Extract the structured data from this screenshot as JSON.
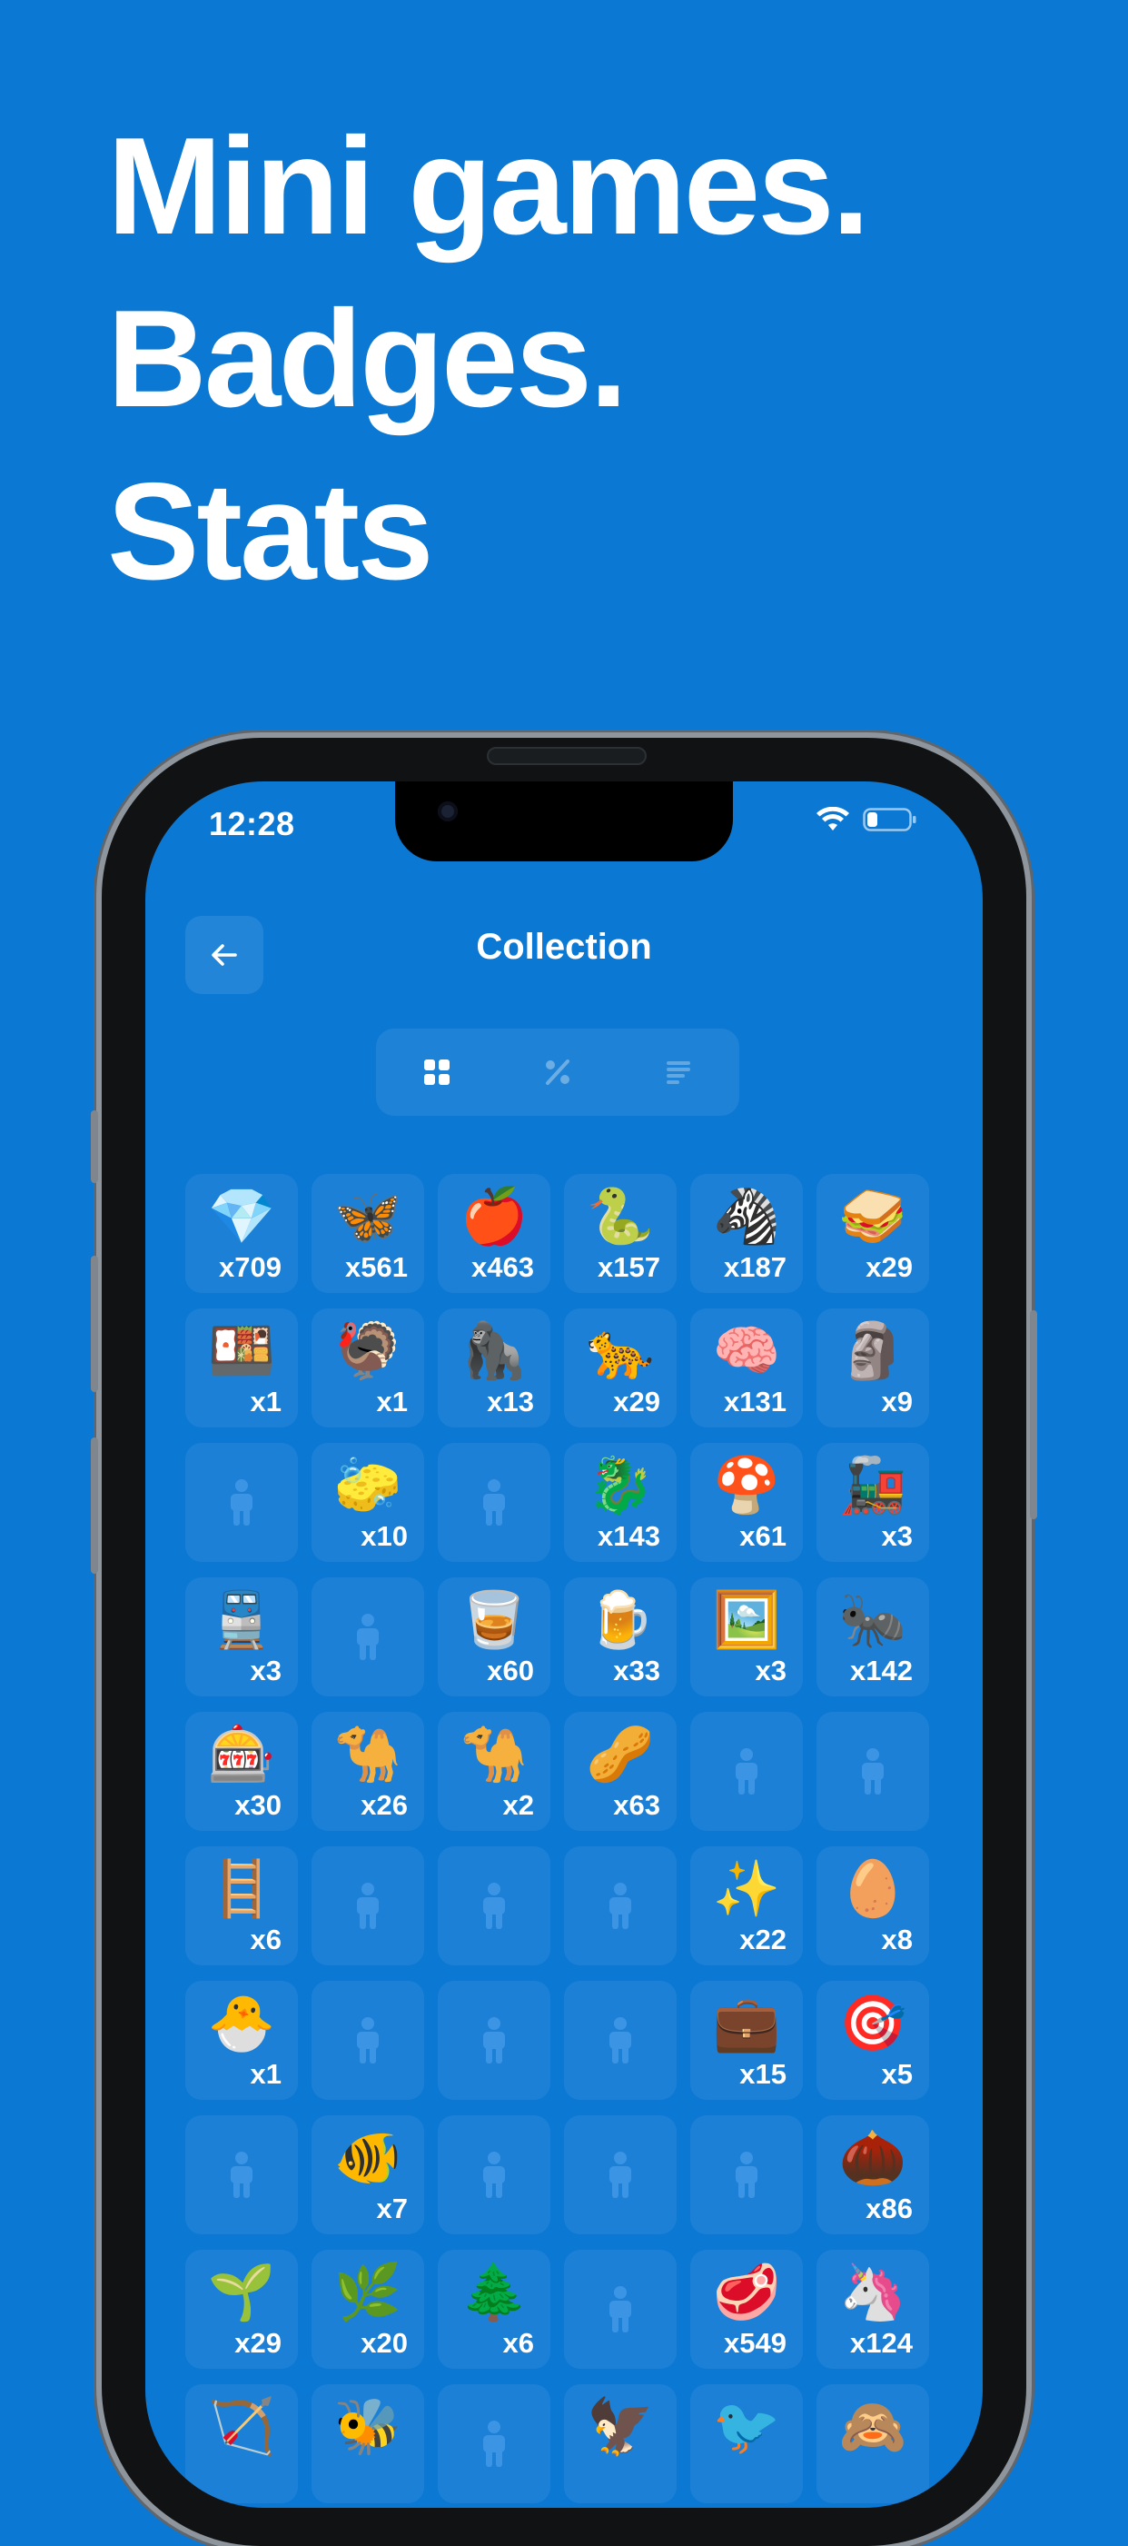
{
  "headline": [
    "Mini games.",
    "Badges.",
    "Stats"
  ],
  "status_bar": {
    "time": "12:28",
    "icons": [
      "wifi-icon",
      "battery-icon"
    ]
  },
  "screen": {
    "title": "Collection",
    "back_icon": "arrow-left-icon",
    "tabs": [
      {
        "icon": "grid-icon",
        "selected": true
      },
      {
        "icon": "percent-icon",
        "selected": false
      },
      {
        "icon": "list-icon",
        "selected": false
      }
    ]
  },
  "collection": [
    {
      "emoji": "💎",
      "count": "x709"
    },
    {
      "emoji": "🦋",
      "count": "x561"
    },
    {
      "emoji": "🍎",
      "count": "x463"
    },
    {
      "emoji": "🐍",
      "count": "x157"
    },
    {
      "emoji": "🦓",
      "count": "x187"
    },
    {
      "emoji": "🥪",
      "count": "x29"
    },
    {
      "emoji": "🍱",
      "count": "x1"
    },
    {
      "emoji": "🦃",
      "count": "x1"
    },
    {
      "emoji": "🦍",
      "count": "x13"
    },
    {
      "emoji": "🐆",
      "count": "x29"
    },
    {
      "emoji": "🧠",
      "count": "x131"
    },
    {
      "emoji": "🗿",
      "count": "x9"
    },
    {
      "locked": true
    },
    {
      "emoji": "🧽",
      "count": "x10"
    },
    {
      "locked": true
    },
    {
      "emoji": "🐉",
      "count": "x143"
    },
    {
      "emoji": "🍄",
      "count": "x61"
    },
    {
      "emoji": "🚂",
      "count": "x3"
    },
    {
      "emoji": "🚆",
      "count": "x3"
    },
    {
      "locked": true
    },
    {
      "emoji": "🥃",
      "count": "x60"
    },
    {
      "emoji": "🍺",
      "count": "x33"
    },
    {
      "emoji": "🖼️",
      "count": "x3"
    },
    {
      "emoji": "🐜",
      "count": "x142"
    },
    {
      "emoji": "🎰",
      "count": "x30"
    },
    {
      "emoji": "🐪",
      "count": "x26"
    },
    {
      "emoji": "🐪",
      "count": "x2"
    },
    {
      "emoji": "🥜",
      "count": "x63"
    },
    {
      "locked": true
    },
    {
      "locked": true
    },
    {
      "emoji": "🪜",
      "count": "x6"
    },
    {
      "locked": true
    },
    {
      "locked": true
    },
    {
      "locked": true
    },
    {
      "emoji": "✨",
      "count": "x22"
    },
    {
      "emoji": "🥚",
      "count": "x8"
    },
    {
      "emoji": "🐣",
      "count": "x1"
    },
    {
      "locked": true
    },
    {
      "locked": true
    },
    {
      "locked": true
    },
    {
      "emoji": "💼",
      "count": "x15"
    },
    {
      "emoji": "🎯",
      "count": "x5"
    },
    {
      "locked": true
    },
    {
      "emoji": "🐠",
      "count": "x7"
    },
    {
      "locked": true
    },
    {
      "locked": true
    },
    {
      "locked": true
    },
    {
      "emoji": "🌰",
      "count": "x86"
    },
    {
      "emoji": "🌱",
      "count": "x29"
    },
    {
      "emoji": "🌿",
      "count": "x20"
    },
    {
      "emoji": "🌲",
      "count": "x6"
    },
    {
      "locked": true
    },
    {
      "emoji": "🥩",
      "count": "x549"
    },
    {
      "emoji": "🦄",
      "count": "x124"
    },
    {
      "emoji": "🏹",
      "count": ""
    },
    {
      "emoji": "🐝",
      "count": ""
    },
    {
      "locked": true
    },
    {
      "emoji": "🦅",
      "count": ""
    },
    {
      "emoji": "🐦",
      "count": ""
    },
    {
      "emoji": "🙈",
      "count": ""
    }
  ]
}
